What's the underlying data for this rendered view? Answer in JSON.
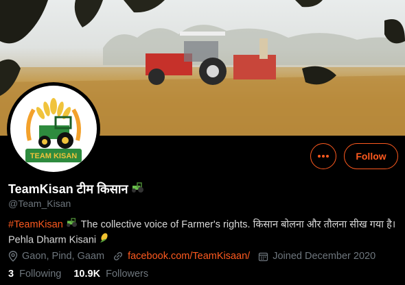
{
  "profile": {
    "display_name": "TeamKisan टीम किसान",
    "handle": "@Team_Kisan",
    "bio_hashtag": "#TeamKisan",
    "bio_text": "The collective voice of Farmer's rights. किसान बोलना और तौलना सीख गया है। Pehla Dharm Kisani",
    "avatar_text": "TEAM KISAN"
  },
  "actions": {
    "follow_label": "Follow",
    "more_icon": "more-horizontal-icon"
  },
  "meta": {
    "location": "Gaon, Pind, Gaam",
    "website": "facebook.com/TeamKisaan/",
    "joined": "Joined December 2020"
  },
  "stats": {
    "following_count": "3",
    "following_label": "Following",
    "followers_count": "10.9K",
    "followers_label": "Followers"
  },
  "colors": {
    "accent": "#ff5a1f",
    "muted": "#6e767d",
    "background": "#000000"
  }
}
